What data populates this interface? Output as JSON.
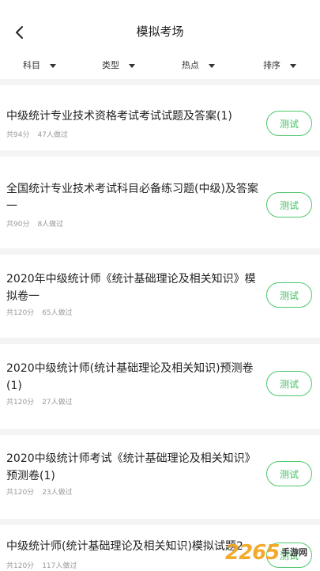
{
  "header": {
    "title": "模拟考场"
  },
  "filters": [
    {
      "label": "科目"
    },
    {
      "label": "类型"
    },
    {
      "label": "热点"
    },
    {
      "label": "排序"
    }
  ],
  "exams": [
    {
      "title": "中级统计专业技术资格考试考试试题及答案(1)",
      "score": "共94分",
      "views": "47人做过",
      "button": "测试"
    },
    {
      "title": "全国统计专业技术考试科目必备练习题(中级)及答案一",
      "score": "共90分",
      "views": "8人做过",
      "button": "测试"
    },
    {
      "title": "2020年中级统计师《统计基础理论及相关知识》模拟卷一",
      "score": "共120分",
      "views": "65人做过",
      "button": "测试"
    },
    {
      "title": "2020中级统计师(统计基础理论及相关知识)预测卷(1)",
      "score": "共120分",
      "views": "27人做过",
      "button": "测试"
    },
    {
      "title": "2020中级统计师考试《统计基础理论及相关知识》预测卷(1)",
      "score": "共120分",
      "views": "23人做过",
      "button": "测试"
    },
    {
      "title": "中级统计师(统计基础理论及相关知识)模拟试题2",
      "score": "共120分",
      "views": "117人做过",
      "button": "测试"
    }
  ],
  "watermark": {
    "number": "2265",
    "text": "手游网"
  },
  "colors": {
    "accent_green": "#4cc86a",
    "divider": "#f4f4f4",
    "meta_gray": "#9a9a9a"
  }
}
